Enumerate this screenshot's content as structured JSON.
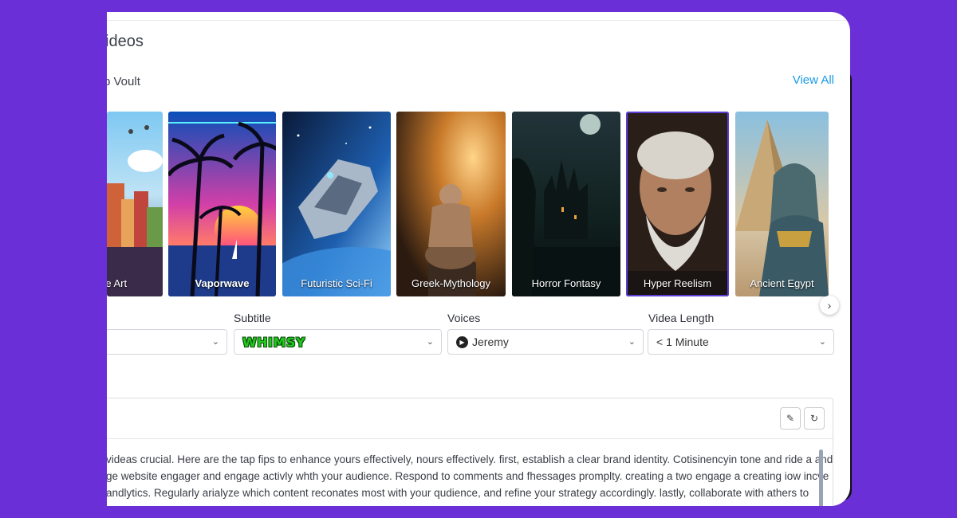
{
  "page": {
    "title": "ideos"
  },
  "vault": {
    "label": "p Voult",
    "view_all": "View All"
  },
  "styles": [
    {
      "label": "re Art"
    },
    {
      "label": "Vaporwave"
    },
    {
      "label": "Futuristic Sci-Fi"
    },
    {
      "label": "Greek-Mythology"
    },
    {
      "label": "Horror Fontasy"
    },
    {
      "label": "Hyper Reelism"
    },
    {
      "label": "Ancient Egypt"
    }
  ],
  "fields": {
    "subtitle": {
      "label": "Subtitle",
      "value": "WHIMSY"
    },
    "voices": {
      "label": "Voices",
      "value": "Jeremy"
    },
    "length": {
      "label": "Videa Length",
      "value": "< 1 Minute"
    }
  },
  "editor": {
    "lines": [
      "videas crucial. Here are the tap fips to enhance yours effectively, nours effectively. first, establish a clear brand identity. Cotisinencyin tone and ride a and",
      "ge website engager and engage activly whth your audience. Respond to comments and fhessages promplty. creating a two engage a creating iow incve",
      "andlytics. Regularly arialyze which content reconates most with your qudience, and refine your strategy accordingly. lastly, collaborate with athers to"
    ]
  },
  "colors": {
    "background": "#6a2fd6",
    "accent": "#1a9be6",
    "selected": "#5b3fd6"
  },
  "icons": {
    "next": "chevron-right-icon",
    "dropdown": "chevron-down-icon",
    "play": "play-icon",
    "edit": "edit-icon",
    "refresh": "refresh-icon"
  }
}
